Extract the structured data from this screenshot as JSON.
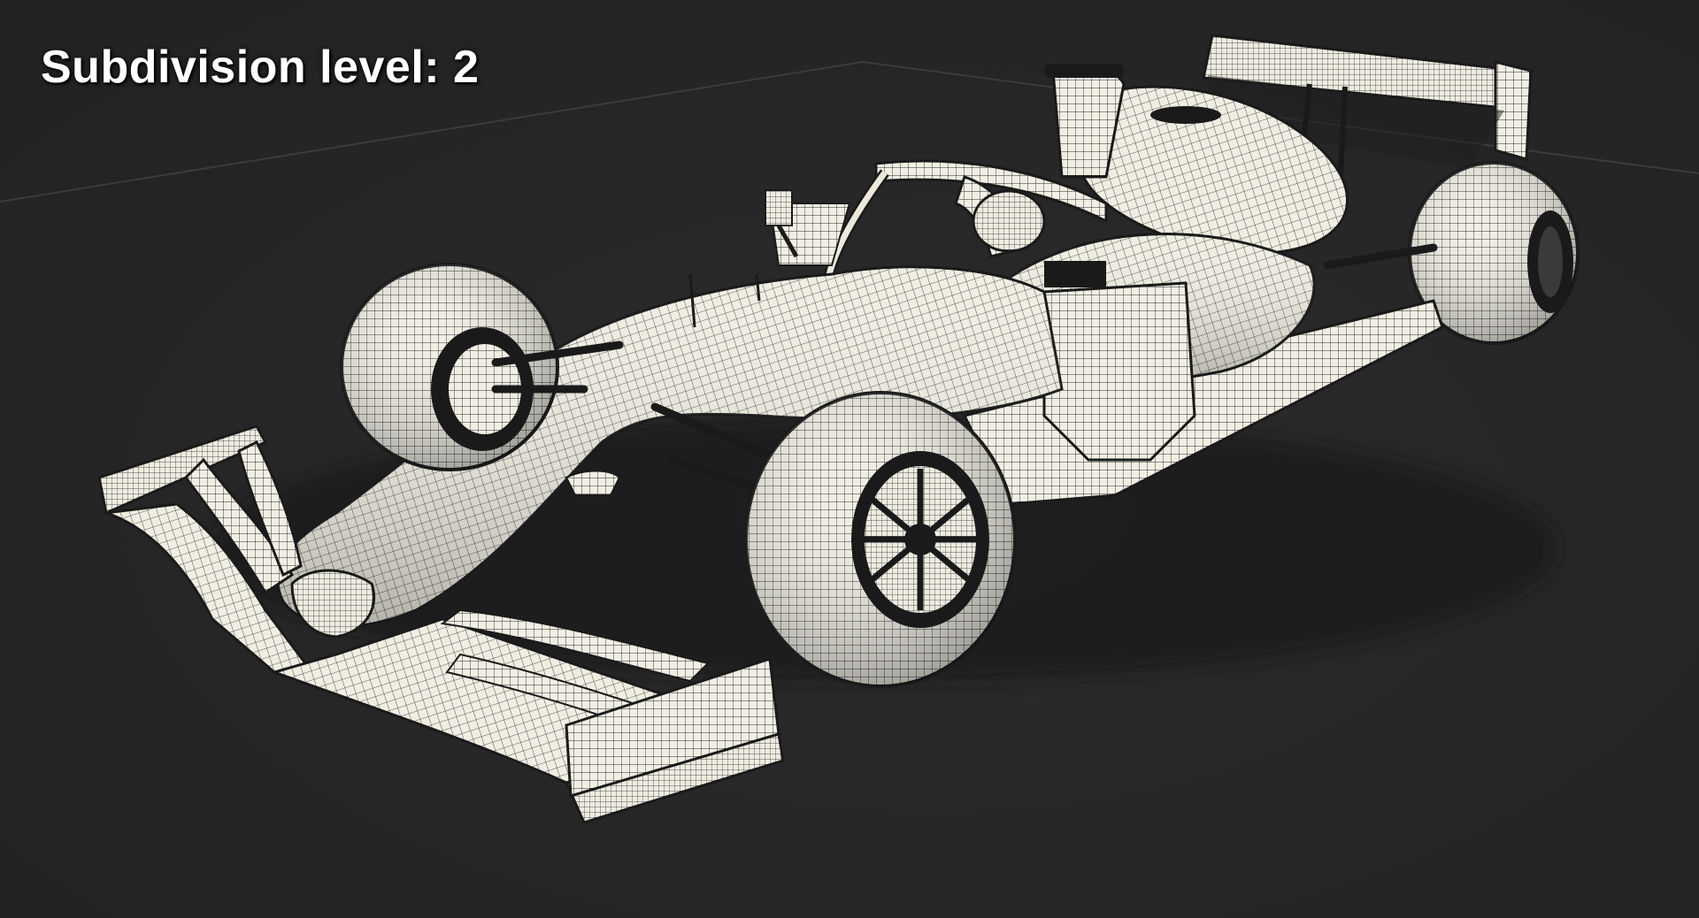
{
  "overlay": {
    "subdivision_label": "Subdivision level: 2"
  },
  "render": {
    "subject": "formula-1-car-wireframe",
    "background_color": "#262626",
    "mesh_fill_color": "#f1efe4",
    "wire_color": "#1c1c1c",
    "grid_line_color": "#3a3a3a"
  }
}
